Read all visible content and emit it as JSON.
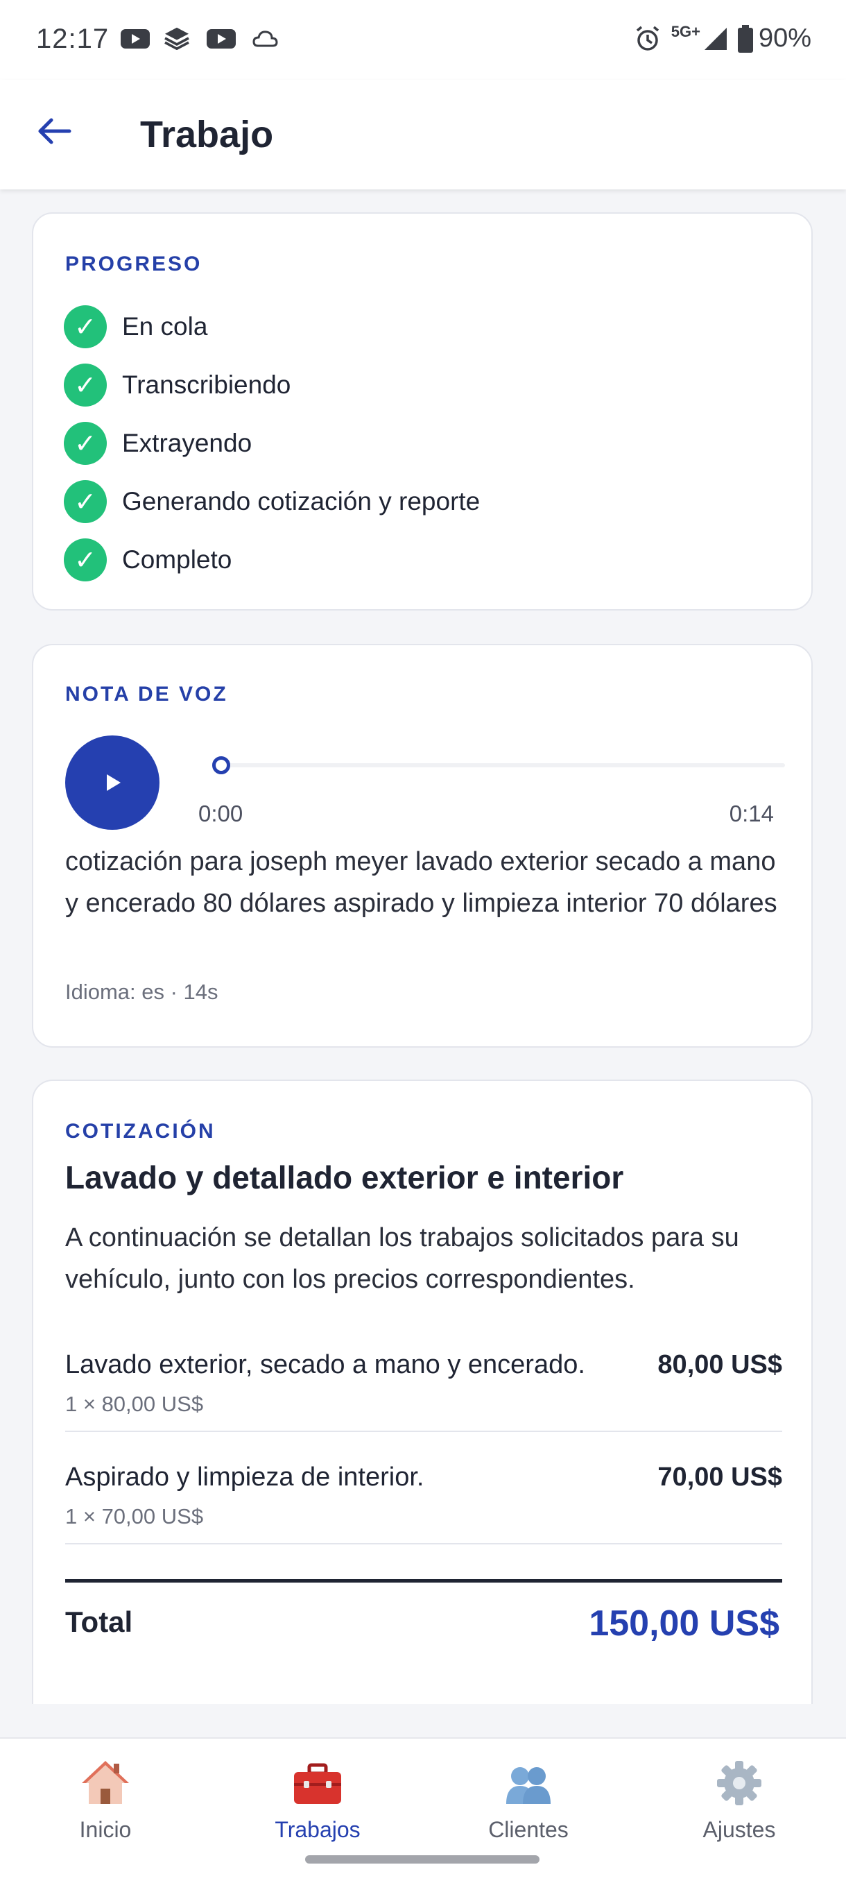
{
  "status_bar": {
    "time": "12:17",
    "network": "5G+",
    "battery": "90%"
  },
  "header": {
    "title": "Trabajo"
  },
  "progress": {
    "label": "PROGRESO",
    "steps": [
      {
        "label": "En cola",
        "done": true
      },
      {
        "label": "Transcribiendo",
        "done": true
      },
      {
        "label": "Extrayendo",
        "done": true
      },
      {
        "label": "Generando cotización y reporte",
        "done": true
      },
      {
        "label": "Completo",
        "done": true
      }
    ]
  },
  "voice_note": {
    "label": "NOTA DE VOZ",
    "current_time": "0:00",
    "duration": "0:14",
    "transcript": "cotización para joseph meyer lavado exterior secado a mano y encerado 80 dólares aspirado y limpieza interior 70 dólares",
    "meta": "Idioma: es · 14s"
  },
  "quote": {
    "label": "COTIZACIÓN",
    "title": "Lavado y detallado exterior e interior",
    "description": "A continuación se detallan los trabajos solicitados para su vehículo, junto con los precios correspondientes.",
    "items": [
      {
        "name": "Lavado exterior, secado a mano y encerado.",
        "price": "80,00 US$",
        "qty": "1 × 80,00 US$"
      },
      {
        "name": "Aspirado y limpieza de interior.",
        "price": "70,00 US$",
        "qty": "1 × 70,00 US$"
      }
    ],
    "total_label": "Total",
    "total_value": "150,00 US$"
  },
  "nav": {
    "items": [
      {
        "label": "Inicio",
        "icon": "house-icon",
        "active": false
      },
      {
        "label": "Trabajos",
        "icon": "toolbox-icon",
        "active": true
      },
      {
        "label": "Clientes",
        "icon": "people-icon",
        "active": false
      },
      {
        "label": "Ajustes",
        "icon": "gear-icon",
        "active": false
      }
    ]
  },
  "colors": {
    "accent": "#2540b0",
    "success": "#22c17a"
  }
}
